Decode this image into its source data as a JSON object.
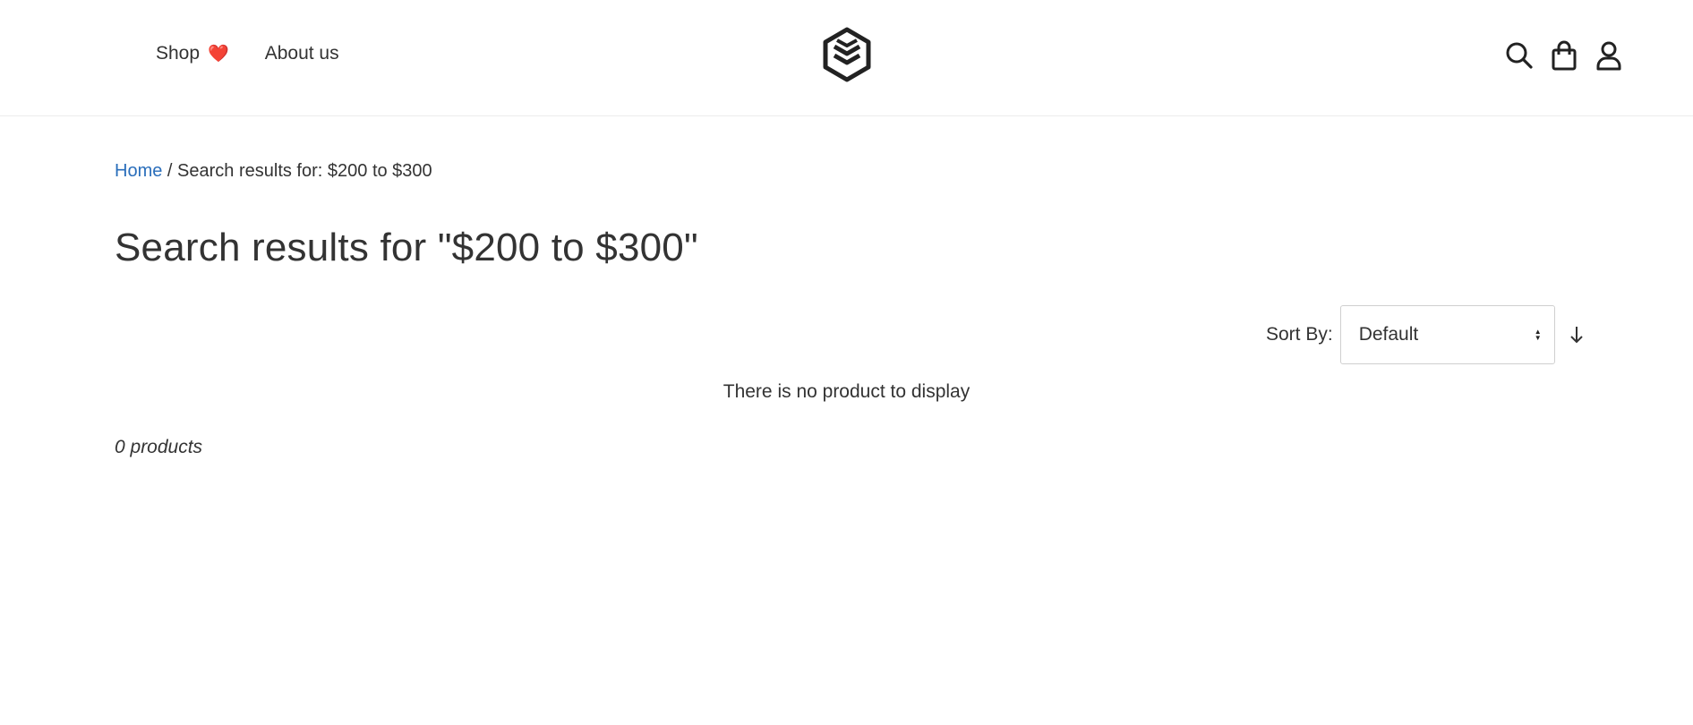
{
  "header": {
    "nav": {
      "shop_label": "Shop",
      "shop_emoji": "❤️",
      "about_label": "About us"
    },
    "logo_icon": "stacked-layers-logo-icon",
    "icons": [
      "search-icon",
      "shopping-bag-icon",
      "user-icon"
    ]
  },
  "breadcrumb": {
    "home_label": "Home",
    "separator": "/",
    "current": "Search results for: $200 to $300"
  },
  "main": {
    "title": "Search results for \"$200 to $300\"",
    "sort": {
      "label": "Sort By:",
      "selected": "Default",
      "direction_icon": "arrow-down-icon"
    },
    "empty_message": "There is no product to display",
    "product_count": "0 products"
  },
  "colors": {
    "link": "#2a6ebb",
    "text": "#333333",
    "heart": "#e8312f",
    "divider": "#ececec"
  }
}
